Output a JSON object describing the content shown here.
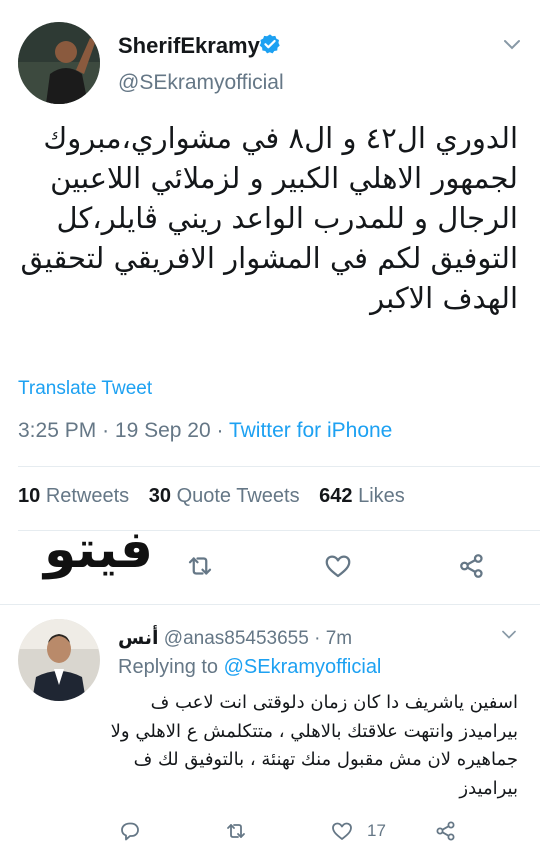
{
  "tweet": {
    "display_name": "SherifEkramy",
    "verified": true,
    "handle": "@SEkramyofficial",
    "text": "الدوري ال٤٢ و ال٨ في مشواري،مبروك لجمهور الاهلي الكبير و لزملائي اللاعبين الرجال و للمدرب الواعد ريني ڤايلر،كل التوفيق لكم في المشوار الافريقي لتحقيق الهدف الاكبر",
    "translate_label": "Translate Tweet",
    "time": "3:25 PM",
    "date": "19 Sep 20",
    "via": "Twitter for iPhone",
    "stats": {
      "retweets_count": "10",
      "retweets_label": "Retweets",
      "quote_count": "30",
      "quote_label": "Quote Tweets",
      "likes_count": "642",
      "likes_label": "Likes"
    },
    "watermark": "فيتو"
  },
  "reply": {
    "name": "أنس",
    "handle": "@anas85453655",
    "age": "7m",
    "replying_prefix": "Replying to",
    "replying_to": "@SEkramyofficial",
    "text": "اسفين ياشريف دا كان زمان دلوقتى انت لاعب ف بيراميدز وانتهت علاقتك بالاهلي ، متتكلمش ع الاهلي ولا جماهيره لان مش مقبول منك تهنئة ، بالتوفيق لك ف بيراميدز",
    "likes": "17"
  },
  "colors": {
    "accent": "#1da1f2",
    "secondary_text": "#657786",
    "primary_text": "#14171a",
    "divider": "#e6ecf0"
  },
  "icons": [
    "verified-badge-icon",
    "chevron-down-icon",
    "reply-icon",
    "retweet-icon",
    "like-icon",
    "share-icon"
  ]
}
